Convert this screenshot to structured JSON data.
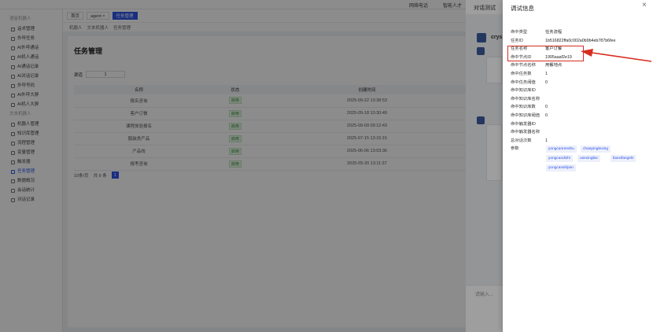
{
  "topbar": {
    "item1": "网络电话",
    "item2": "智能人才"
  },
  "sidebar": {
    "group1": "语音机器人",
    "items1": [
      "话术管理",
      "外呼任务",
      "AI外呼通话",
      "AI机人通话",
      "AI通话记录",
      "AI对话记录",
      "外呼号码",
      "AI外呼大屏",
      "AI机人大屏"
    ],
    "group2": "文本机器人",
    "items2": [
      "机器人管理",
      "知识库管理",
      "流程管理",
      "变量管理",
      "触发器",
      "任务管理",
      "数据概况",
      "会话统计",
      "对话记录"
    ]
  },
  "main": {
    "tabs": [
      "首页",
      "agent ×",
      "任务管理"
    ],
    "crumbs": [
      "机器人",
      "文本机器人",
      "任务管理"
    ],
    "page_title": "任务管理",
    "filter_label": "渠道",
    "filter_value": "1",
    "table": {
      "headers": [
        "名称",
        "状态",
        "创建时间"
      ],
      "rows": [
        [
          "报名咨询",
          "启用",
          "2025-09-22 13:38:53"
        ],
        [
          "客户订餐",
          "启用",
          "2025-09-18 10:30:49"
        ],
        [
          "课程体验报名",
          "启用",
          "2025-09-09 09:12:43"
        ],
        [
          "服装类产品",
          "启用",
          "2025-07-15 13:15:15"
        ],
        [
          "产品线",
          "启用",
          "2025-06-06 13:03:36"
        ],
        [
          "报考咨询",
          "启用",
          "2025-05-20 13:11:37"
        ]
      ]
    },
    "pager": {
      "page_size": "10条/页",
      "total": "共 6 条",
      "current": "1"
    }
  },
  "chat": {
    "title": "对话测试",
    "sender": "crys",
    "input_placeholder": "请输入..."
  },
  "drawer": {
    "title": "调试信息",
    "close": "×",
    "fields": [
      {
        "key": "命中类型",
        "value": "任务流程"
      },
      {
        "key": "任务ID",
        "value": "1b516822ffa0c002a0b9b4eb787b6fee"
      },
      {
        "key": "任务名称",
        "value": "客户订餐"
      },
      {
        "key": "命中节点ID",
        "value": "1995aaaf2e19"
      },
      {
        "key": "命中节点名称",
        "value": "用餐地点"
      },
      {
        "key": "命中任务数",
        "value": "1"
      },
      {
        "key": "命中任务阈值",
        "value": "0"
      },
      {
        "key": "命中知识库ID",
        "value": ""
      },
      {
        "key": "命中知识库名称",
        "value": ""
      },
      {
        "key": "命中知识库数",
        "value": "0"
      },
      {
        "key": "命中知识库阈值",
        "value": "0"
      },
      {
        "key": "命中触发器ID",
        "value": ""
      },
      {
        "key": "命中触发器名称",
        "value": ""
      },
      {
        "key": "总对话次数",
        "value": "1"
      },
      {
        "key": "参数",
        "value": ""
      }
    ],
    "params": [
      "yongcanrenshu",
      "chanpinglexing",
      "yongcandizhi",
      "usexingbie",
      "lianxifangshi",
      "yongcanshijian"
    ],
    "accent": "#d62d20"
  }
}
